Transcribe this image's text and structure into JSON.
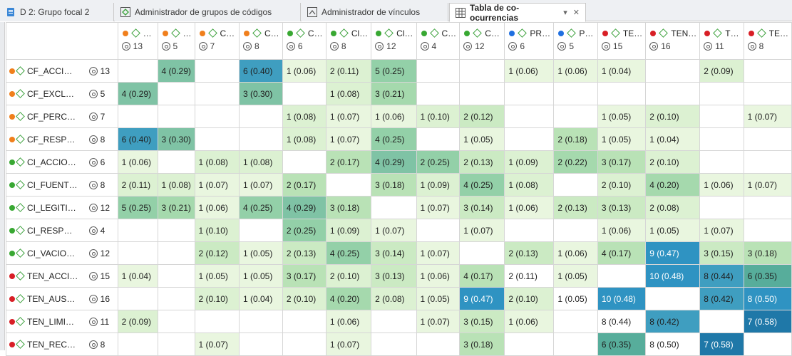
{
  "tabs": [
    {
      "label": "D 2: Grupo focal 2",
      "icon": "document-icon",
      "active": false
    },
    {
      "label": "Administrador de grupos de códigos",
      "icon": "code-groups-icon",
      "active": false
    },
    {
      "label": "Administrador de vínculos",
      "icon": "links-icon",
      "active": false
    },
    {
      "label": "Tabla de co-ocurrencias",
      "icon": "table-icon",
      "active": true
    }
  ],
  "group_colors": {
    "CF": "#f07f1c",
    "CI": "#38a832",
    "PR": "#1f6fe0",
    "TEN": "#d81f26"
  },
  "columns": [
    {
      "label": "…",
      "group": "CF",
      "count": "13"
    },
    {
      "label": "…",
      "group": "CF",
      "count": "5"
    },
    {
      "label": "C…",
      "group": "CF",
      "count": "7"
    },
    {
      "label": "C…",
      "group": "CF",
      "count": "8"
    },
    {
      "label": "C…",
      "group": "CI",
      "count": "6"
    },
    {
      "label": "Cl…",
      "group": "CI",
      "count": "8"
    },
    {
      "label": "Cl…",
      "group": "CI",
      "count": "12"
    },
    {
      "label": "C…",
      "group": "CI",
      "count": "4"
    },
    {
      "label": "C…",
      "group": "CI",
      "count": "12"
    },
    {
      "label": "PR…",
      "group": "PR",
      "count": "6"
    },
    {
      "label": "P…",
      "group": "PR",
      "count": "5"
    },
    {
      "label": "TE…",
      "group": "TEN",
      "count": "15"
    },
    {
      "label": "TEN…",
      "group": "TEN",
      "count": "16"
    },
    {
      "label": "T…",
      "group": "TEN",
      "count": "11"
    },
    {
      "label": "TE…",
      "group": "TEN",
      "count": "8"
    }
  ],
  "rows": [
    {
      "label": "CF_ACCIO…",
      "group": "CF",
      "count": "13",
      "cells": [
        "",
        "4 (0.29)",
        "",
        "6 (0.40)",
        "1 (0.06)",
        "2 (0.11)",
        "5 (0.25)",
        "",
        "",
        "1 (0.06)",
        "1 (0.06)",
        "1 (0.04)",
        "",
        "2 (0.09)",
        ""
      ]
    },
    {
      "label": "CF_EXCLUS…",
      "group": "CF",
      "count": "5",
      "cells": [
        "4 (0.29)",
        "",
        "",
        "3 (0.30)",
        "",
        "1 (0.08)",
        "3 (0.21)",
        "",
        "",
        "",
        "",
        "",
        "",
        "",
        ""
      ]
    },
    {
      "label": "CF_PERCEP…",
      "group": "CF",
      "count": "7",
      "cells": [
        "",
        "",
        "",
        "",
        "1 (0.08)",
        "1 (0.07)",
        "1 (0.06)",
        "1 (0.10)",
        "2 (0.12)",
        "",
        "",
        "1 (0.05)",
        "2 (0.10)",
        "",
        "1 (0.07)"
      ]
    },
    {
      "label": "CF_RESPUE…",
      "group": "CF",
      "count": "8",
      "cells": [
        "6 (0.40)",
        "3 (0.30)",
        "",
        "",
        "1 (0.08)",
        "1 (0.07)",
        "4 (0.25)",
        "",
        "1 (0.05)",
        "",
        "2 (0.18)",
        "1 (0.05)",
        "1 (0.04)",
        "",
        ""
      ]
    },
    {
      "label": "CI_ACCION…",
      "group": "CI",
      "count": "6",
      "cells": [
        "1 (0.06)",
        "",
        "1 (0.08)",
        "1 (0.08)",
        "",
        "2 (0.17)",
        "4 (0.29)",
        "2 (0.25)",
        "2 (0.13)",
        "1 (0.09)",
        "2 (0.22)",
        "3 (0.17)",
        "2 (0.10)",
        "",
        ""
      ]
    },
    {
      "label": "CI_FUENTE…",
      "group": "CI",
      "count": "8",
      "cells": [
        "2 (0.11)",
        "1 (0.08)",
        "1 (0.07)",
        "1 (0.07)",
        "2 (0.17)",
        "",
        "3 (0.18)",
        "1 (0.09)",
        "4 (0.25)",
        "1 (0.08)",
        "",
        "2 (0.10)",
        "4 (0.20)",
        "1 (0.06)",
        "1 (0.07)"
      ]
    },
    {
      "label": "CI_LEGITIMI…",
      "group": "CI",
      "count": "12",
      "cells": [
        "5 (0.25)",
        "3 (0.21)",
        "1 (0.06)",
        "4 (0.25)",
        "4 (0.29)",
        "3 (0.18)",
        "",
        "1 (0.07)",
        "3 (0.14)",
        "1 (0.06)",
        "2 (0.13)",
        "3 (0.13)",
        "2 (0.08)",
        "",
        ""
      ]
    },
    {
      "label": "CI_RESPUES…",
      "group": "CI",
      "count": "4",
      "cells": [
        "",
        "",
        "1 (0.10)",
        "",
        "2 (0.25)",
        "1 (0.09)",
        "1 (0.07)",
        "",
        "1 (0.07)",
        "",
        "",
        "1 (0.06)",
        "1 (0.05)",
        "1 (0.07)",
        ""
      ]
    },
    {
      "label": "CI_VACIO_…",
      "group": "CI",
      "count": "12",
      "cells": [
        "",
        "",
        "2 (0.12)",
        "1 (0.05)",
        "2 (0.13)",
        "4 (0.25)",
        "3 (0.14)",
        "1 (0.07)",
        "",
        "2 (0.13)",
        "1 (0.06)",
        "4 (0.17)",
        "9 (0.47)",
        "3 (0.15)",
        "3 (0.18)"
      ]
    },
    {
      "label": "TEN_ACCIO…",
      "group": "TEN",
      "count": "15",
      "cells": [
        "1 (0.04)",
        "",
        "1 (0.05)",
        "1 (0.05)",
        "3 (0.17)",
        "2 (0.10)",
        "3 (0.13)",
        "1 (0.06)",
        "4 (0.17)",
        "2 (0.11)",
        "1 (0.05)",
        "",
        "10 (0.48)",
        "8 (0.44)",
        "6 (0.35)"
      ]
    },
    {
      "label": "TEN_AUSE…",
      "group": "TEN",
      "count": "16",
      "cells": [
        "",
        "",
        "2 (0.10)",
        "1 (0.04)",
        "2 (0.10)",
        "4 (0.20)",
        "2 (0.08)",
        "1 (0.05)",
        "9 (0.47)",
        "2 (0.10)",
        "1 (0.05)",
        "10 (0.48)",
        "",
        "8 (0.42)",
        "8 (0.50)"
      ]
    },
    {
      "label": "TEN_LIMITA…",
      "group": "TEN",
      "count": "11",
      "cells": [
        "2 (0.09)",
        "",
        "",
        "",
        "",
        "1 (0.06)",
        "",
        "1 (0.07)",
        "3 (0.15)",
        "1 (0.06)",
        "",
        "8 (0.44)",
        "8 (0.42)",
        "",
        "7 (0.58)"
      ]
    },
    {
      "label": "TEN_RECO…",
      "group": "TEN",
      "count": "8",
      "cells": [
        "",
        "",
        "1 (0.07)",
        "",
        "",
        "1 (0.07)",
        "",
        "",
        "3 (0.18)",
        "",
        "",
        "6 (0.35)",
        "8 (0.50)",
        "7 (0.58)",
        ""
      ]
    }
  ]
}
